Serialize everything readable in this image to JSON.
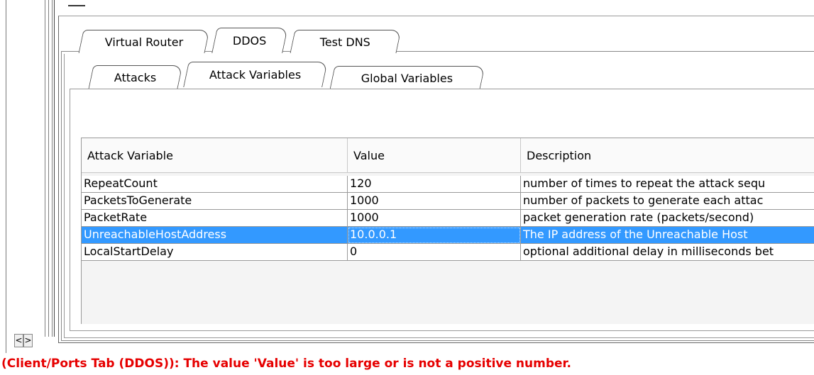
{
  "tabs_level1": [
    {
      "label": "Virtual Router",
      "active": false
    },
    {
      "label": "DDOS",
      "active": true
    },
    {
      "label": "Test DNS",
      "active": false
    }
  ],
  "tabs_level2": [
    {
      "label": "Attacks",
      "active": false
    },
    {
      "label": "Attack Variables",
      "active": true
    },
    {
      "label": "Global Variables",
      "active": false
    }
  ],
  "table": {
    "columns": [
      "Attack Variable",
      "Value",
      "Description"
    ],
    "rows": [
      {
        "variable": "RepeatCount",
        "value": "120",
        "description": "number of times to repeat the attack sequ"
      },
      {
        "variable": "PacketsToGenerate",
        "value": "1000",
        "description": "number of packets to generate each attac"
      },
      {
        "variable": "PacketRate",
        "value": "1000",
        "description": "packet generation rate (packets/second)"
      },
      {
        "variable": "UnreachableHostAddress",
        "value": "10.0.0.1",
        "description": "The IP address of the Unreachable Host",
        "selected": true
      },
      {
        "variable": "LocalStartDelay",
        "value": "0",
        "description": "optional additional delay in milliseconds bet"
      }
    ]
  },
  "scroll_buttons": {
    "left": "<",
    "right": ">"
  },
  "status_message": "(Client/Ports Tab (DDOS)): The value 'Value' is too large or is not a positive number.",
  "colors": {
    "selection": "#3399ff",
    "error_text": "#e60000"
  }
}
